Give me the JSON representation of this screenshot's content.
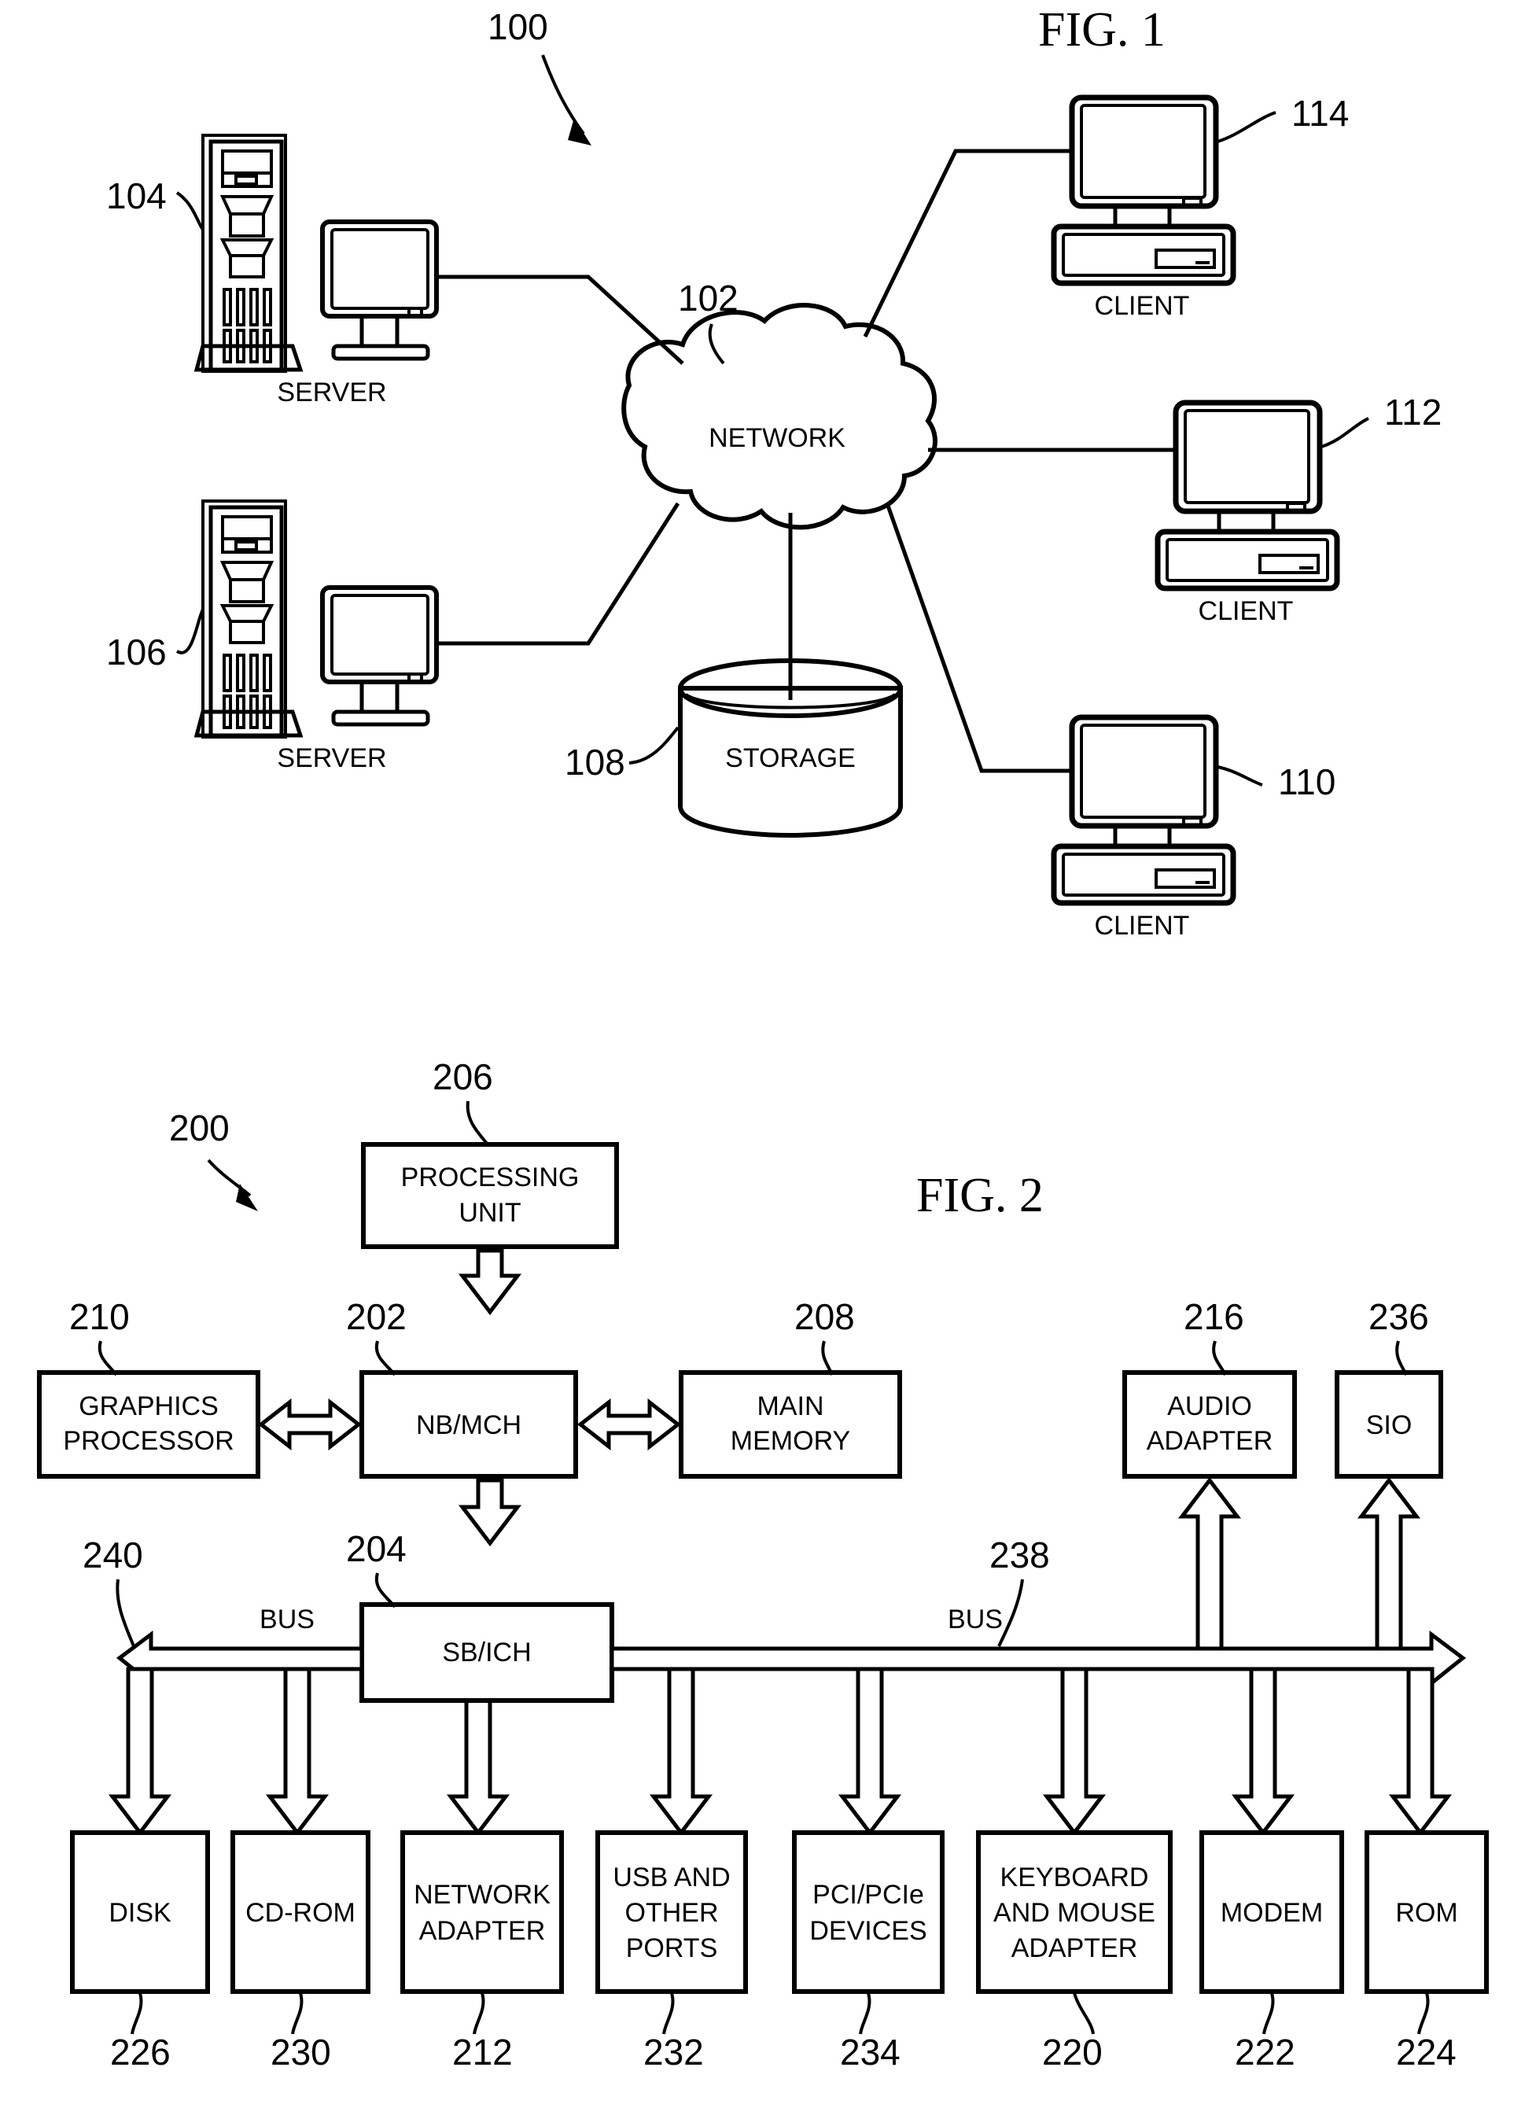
{
  "figures": [
    {
      "id": "fig1",
      "title": "FIG. 1",
      "system_ref": "100",
      "nodes": {
        "network": {
          "label": "NETWORK",
          "ref": "102"
        },
        "storage": {
          "label": "STORAGE",
          "ref": "108"
        },
        "server_top": {
          "label": "SERVER",
          "ref": "104"
        },
        "server_bottom": {
          "label": "SERVER",
          "ref": "106"
        },
        "client_top": {
          "label": "CLIENT",
          "ref": "114"
        },
        "client_mid": {
          "label": "CLIENT",
          "ref": "112"
        },
        "client_bottom": {
          "label": "CLIENT",
          "ref": "110"
        }
      }
    },
    {
      "id": "fig2",
      "title": "FIG. 2",
      "system_ref": "200",
      "blocks": [
        {
          "key": "processing_unit",
          "label_lines": [
            "PROCESSING",
            "UNIT"
          ],
          "ref": "206"
        },
        {
          "key": "graphics_processor",
          "label_lines": [
            "GRAPHICS",
            "PROCESSOR"
          ],
          "ref": "210"
        },
        {
          "key": "nb_mch",
          "label_lines": [
            "NB/MCH"
          ],
          "ref": "202"
        },
        {
          "key": "main_memory",
          "label_lines": [
            "MAIN",
            "MEMORY"
          ],
          "ref": "208"
        },
        {
          "key": "audio_adapter",
          "label_lines": [
            "AUDIO",
            "ADAPTER"
          ],
          "ref": "216"
        },
        {
          "key": "sio",
          "label_lines": [
            "SIO"
          ],
          "ref": "236"
        },
        {
          "key": "sb_ich",
          "label_lines": [
            "SB/ICH"
          ],
          "ref": "204"
        },
        {
          "key": "disk",
          "label_lines": [
            "DISK"
          ],
          "ref": "226"
        },
        {
          "key": "cd_rom",
          "label_lines": [
            "CD-ROM"
          ],
          "ref": "230"
        },
        {
          "key": "network_adapter",
          "label_lines": [
            "NETWORK",
            "ADAPTER"
          ],
          "ref": "212"
        },
        {
          "key": "usb_other_ports",
          "label_lines": [
            "USB AND",
            "OTHER",
            "PORTS"
          ],
          "ref": "232"
        },
        {
          "key": "pci_pcie_devices",
          "label_lines": [
            "PCI/PCIe",
            "DEVICES"
          ],
          "ref": "234"
        },
        {
          "key": "keyboard_mouse_adapter",
          "label_lines": [
            "KEYBOARD",
            "AND MOUSE",
            "ADAPTER"
          ],
          "ref": "220"
        },
        {
          "key": "modem",
          "label_lines": [
            "MODEM"
          ],
          "ref": "222"
        },
        {
          "key": "rom",
          "label_lines": [
            "ROM"
          ],
          "ref": "224"
        }
      ],
      "buses": [
        {
          "key": "bus_left",
          "label": "BUS",
          "ref": "240"
        },
        {
          "key": "bus_right",
          "label": "BUS",
          "ref": "238"
        }
      ]
    }
  ],
  "colors": {
    "ink": "#000000",
    "paper": "#ffffff"
  }
}
